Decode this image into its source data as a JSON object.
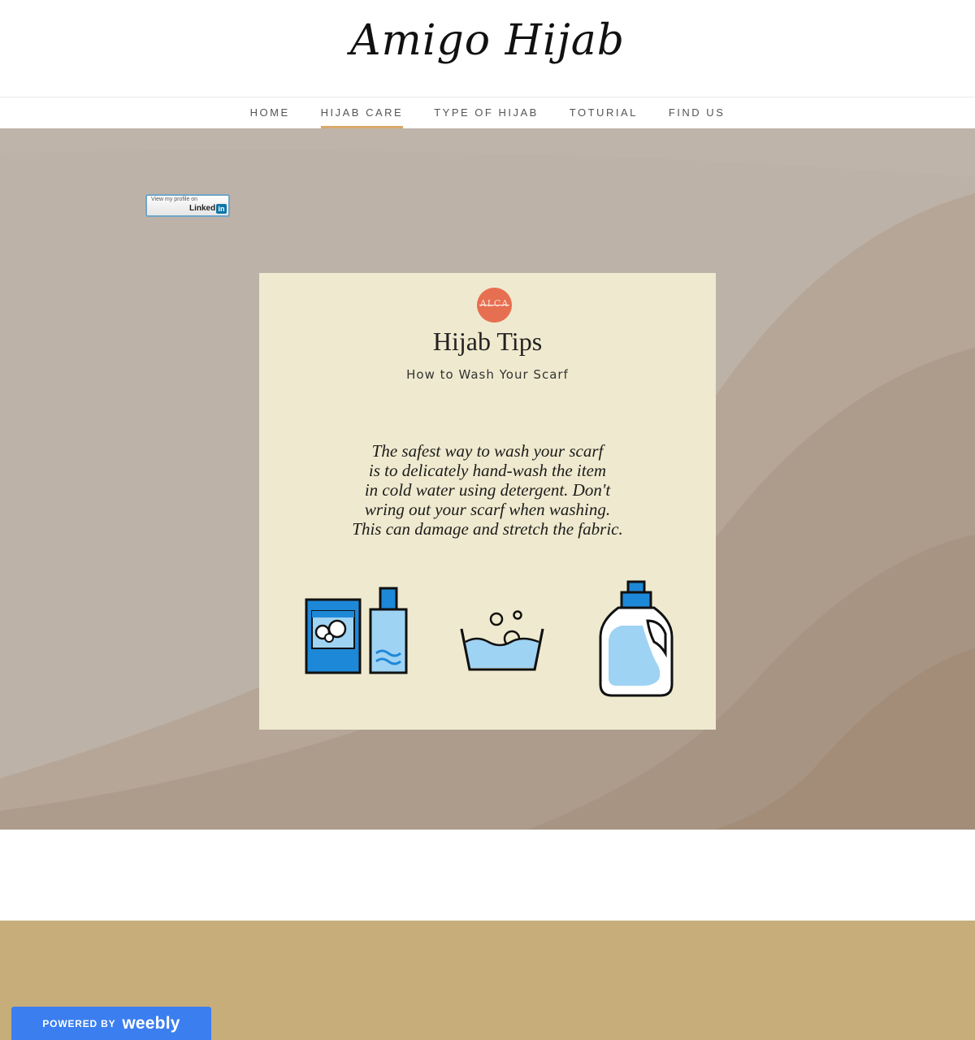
{
  "site": {
    "title": "Amigo Hijab"
  },
  "nav": {
    "items": [
      {
        "label": "HOME",
        "active": false
      },
      {
        "label": "HIJAB CARE",
        "active": true
      },
      {
        "label": "TYPE OF HIJAB",
        "active": false
      },
      {
        "label": "TOTURIAL",
        "active": false
      },
      {
        "label": "FIND US",
        "active": false
      }
    ],
    "active_color": "#d9a96b"
  },
  "linkedin_badge": {
    "small_text": "View my profile on",
    "brand": "Linked",
    "in": "in"
  },
  "card": {
    "logo_text": "ALCA",
    "title": "Hijab Tips",
    "subtitle": "How to Wash Your Scarf",
    "body_lines": [
      "The safest way to wash your scarf",
      "is to delicately hand-wash the item",
      "in cold water using detergent. Don't",
      "wring out your scarf when washing.",
      "This can damage and stretch the fabric."
    ],
    "icons": [
      "detergent-box-and-bottle-icon",
      "wash-basin-icon",
      "detergent-jug-icon"
    ],
    "background_color": "#efeacf",
    "logo_color": "#e76f51"
  },
  "footer": {
    "color": "#c7ad79"
  },
  "weebly": {
    "small": "POWERED BY",
    "brand": "weebly",
    "color": "#3b7ef0"
  }
}
